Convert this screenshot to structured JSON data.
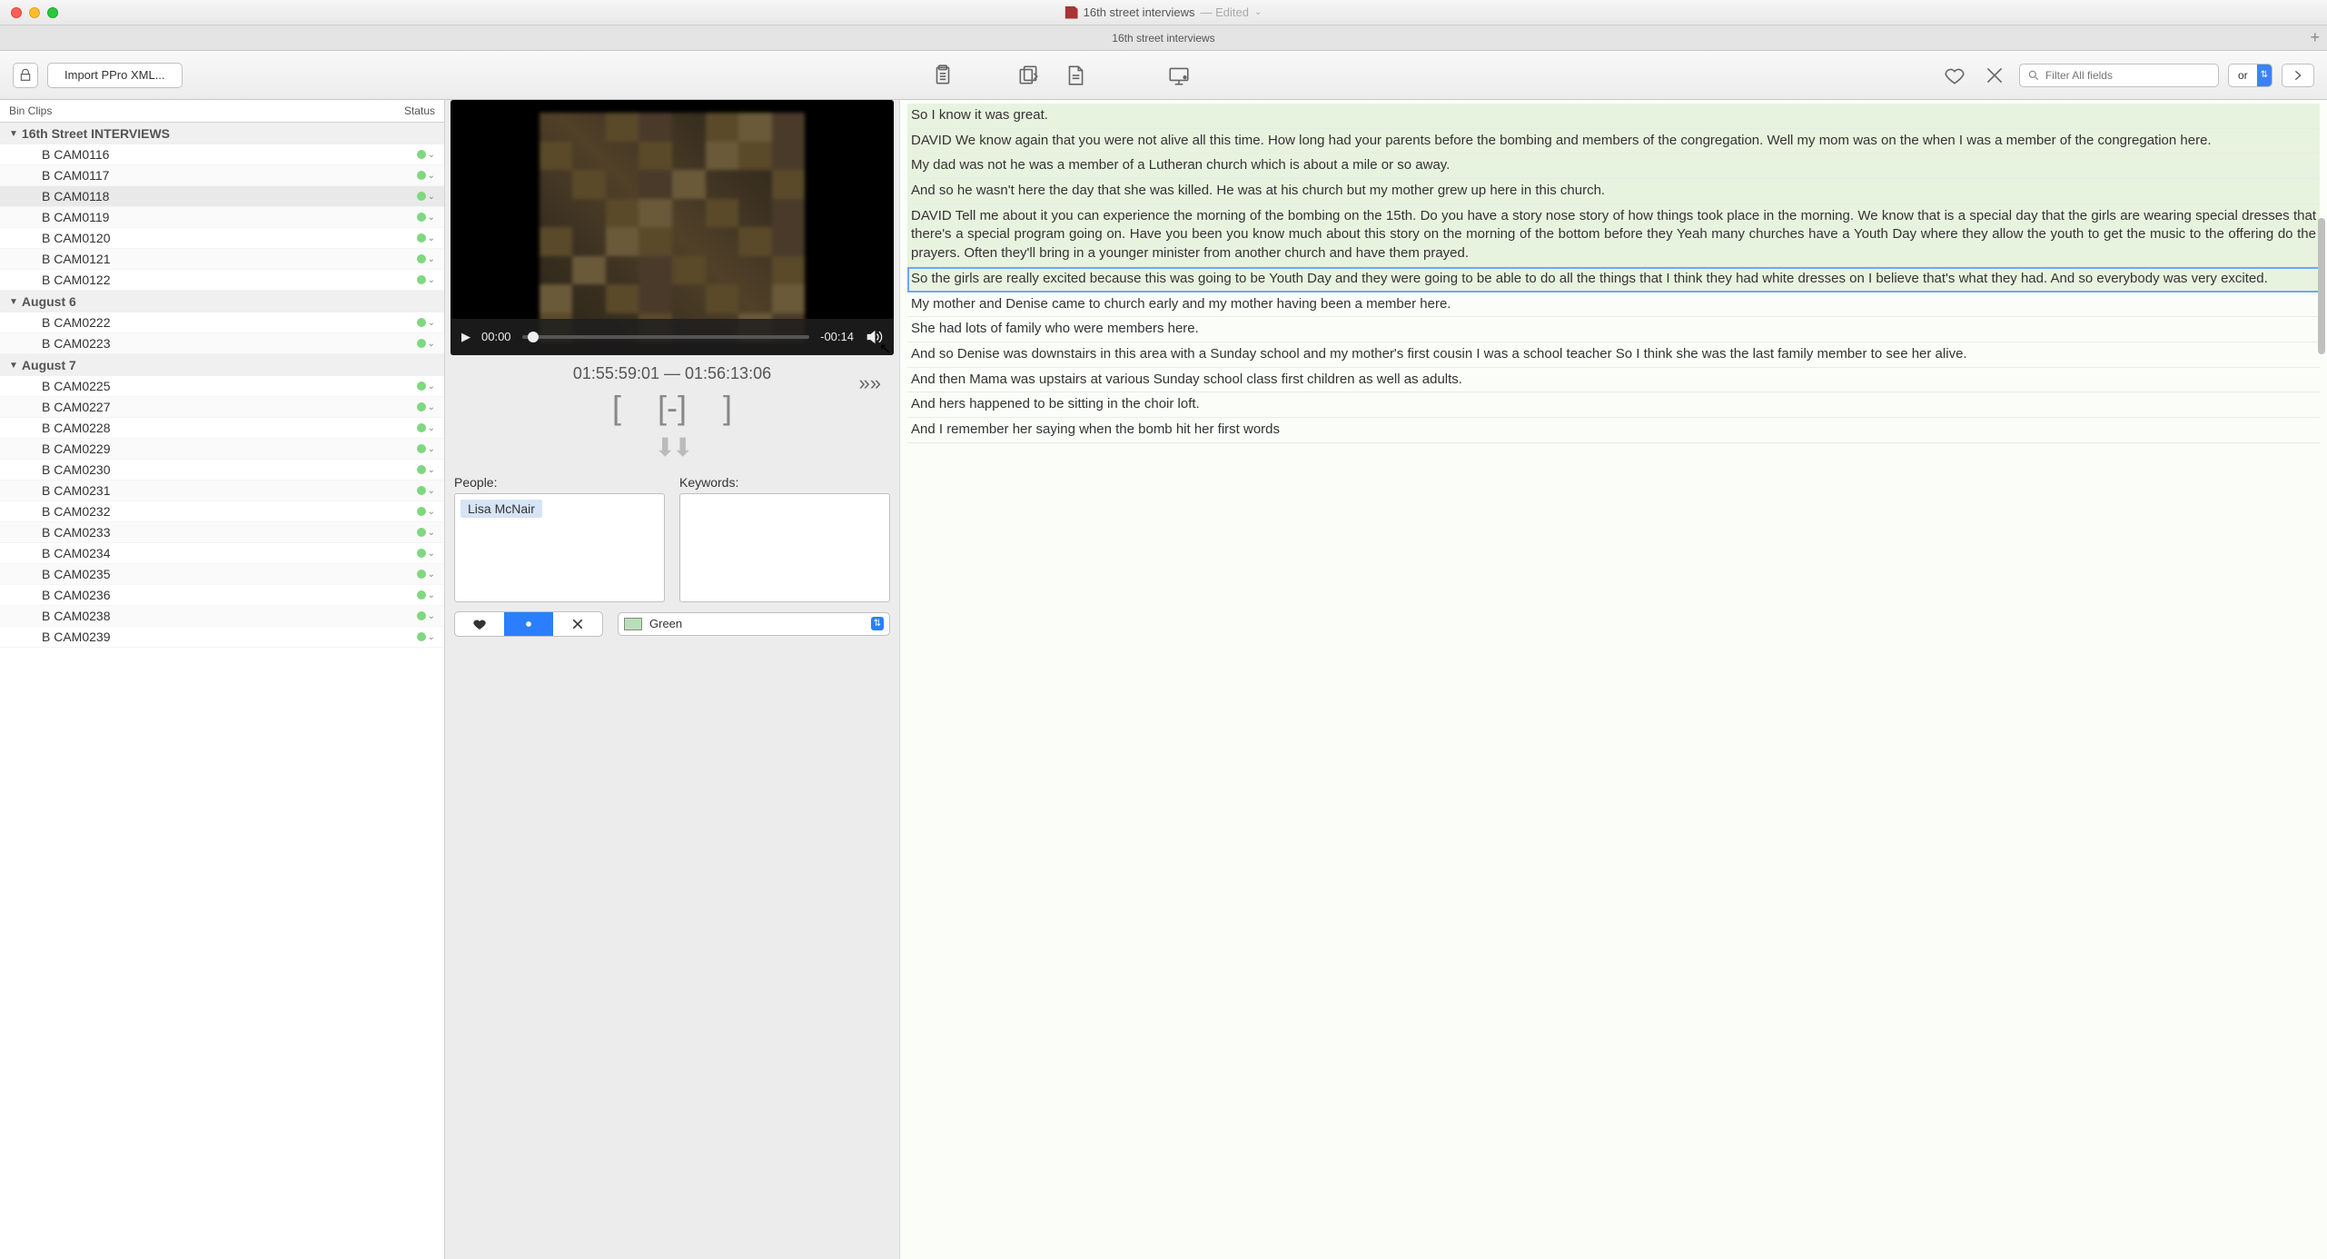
{
  "window": {
    "title": "16th street interviews",
    "edited_suffix": " — Edited",
    "tab_label": "16th street interviews"
  },
  "toolbar": {
    "import_label": "Import PPro XML...",
    "search_placeholder": "Filter All fields",
    "filter_mode": "or"
  },
  "bin": {
    "col_clips": "Bin Clips",
    "col_status": "Status",
    "groups": [
      {
        "name": "16th Street INTERVIEWS",
        "clips": [
          "B CAM0116",
          "B CAM0117",
          "B CAM0118",
          "B CAM0119",
          "B CAM0120",
          "B CAM0121",
          "B CAM0122"
        ],
        "selected": "B CAM0118"
      },
      {
        "name": "August 6",
        "clips": [
          "B CAM0222",
          "B CAM0223"
        ]
      },
      {
        "name": "August 7",
        "clips": [
          "B CAM0225",
          "B CAM0227",
          "B CAM0228",
          "B CAM0229",
          "B CAM0230",
          "B CAM0231",
          "B CAM0232",
          "B CAM0233",
          "B CAM0234",
          "B CAM0235",
          "B CAM0236",
          "B CAM0238",
          "B CAM0239"
        ]
      }
    ]
  },
  "player": {
    "current_time": "00:00",
    "remaining": "-00:14",
    "tc_in": "01:55:59:01",
    "tc_out": "01:56:13:06",
    "tc_sep": " — "
  },
  "meta": {
    "people_label": "People:",
    "keywords_label": "Keywords:",
    "people": [
      "Lisa McNair"
    ],
    "color_name": "Green",
    "color_hex": "#b8e0b8"
  },
  "transcript": [
    {
      "cls": "hl-green",
      "text": "So I know it was great."
    },
    {
      "cls": "hl-green",
      "text": "DAVID We know again that you were not alive all this time. How long had your parents before the bombing and members of the congregation. Well my mom was on the when I was a member of the congregation here."
    },
    {
      "cls": "hl-green",
      "text": "My dad was not he was a member of a Lutheran church which is about a mile or so away."
    },
    {
      "cls": "hl-green",
      "text": "And so he wasn't here the day that she was killed. He was at his church but my mother grew up here in this church."
    },
    {
      "cls": "hl-green",
      "text": "DAVID Tell me about it you can experience the morning of the bombing on the 15th. Do you have a story nose story of how things took place in the morning. We know that is a special day that the girls are wearing special dresses that there's a special program going on. Have you been you know much about this story on the morning of the bottom before they Yeah many churches have a Youth Day where they allow the youth to get the music to the offering do the prayers. Often they'll bring in a younger minister from another church and have them prayed."
    },
    {
      "cls": "hl-sel",
      "text": "So the girls are really excited because this was going to be Youth Day and they were going to be able to do all the things that I think they had white dresses on I believe that's what they had. And so everybody was very excited."
    },
    {
      "cls": "",
      "text": "My mother and Denise came to church early and my mother having been a member here."
    },
    {
      "cls": "",
      "text": "She had lots of family who were members here."
    },
    {
      "cls": "",
      "text": "And so Denise was downstairs in this area with a Sunday school and my mother's first cousin I was a school teacher So I think she was the last family member to see her alive."
    },
    {
      "cls": "",
      "text": "And then Mama was upstairs at various Sunday school class first children as well as adults."
    },
    {
      "cls": "",
      "text": "And hers happened to be sitting in the choir loft."
    },
    {
      "cls": "",
      "text": "And I remember her saying when the bomb hit her first words"
    }
  ]
}
